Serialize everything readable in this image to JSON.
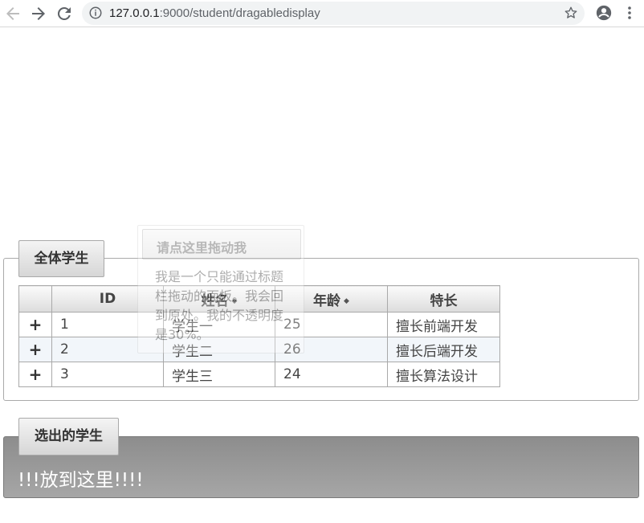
{
  "browser": {
    "url_host": "127.0.0.1",
    "url_rest": ":9000/student/dragabledisplay"
  },
  "all_students": {
    "button_label": "全体学生",
    "headers": [
      "ID",
      "姓名",
      "年龄",
      "特长"
    ],
    "rows": [
      {
        "expand": "+",
        "id": "1",
        "name": "学生一",
        "age": "25",
        "skill": "擅长前端开发"
      },
      {
        "expand": "+",
        "id": "2",
        "name": "学生二",
        "age": "26",
        "skill": "擅长后端开发"
      },
      {
        "expand": "+",
        "id": "3",
        "name": "学生三",
        "age": "24",
        "skill": "擅长算法设计"
      }
    ]
  },
  "selected_students": {
    "button_label": "选出的学生",
    "drop_text": "!!!放到这里!!!!"
  },
  "drag_panel": {
    "title": "请点这里拖动我",
    "body": "我是一个只能通过标题栏拖动的面板。我会回到原处。我的不透明度是30%。"
  },
  "colors": {
    "drop_zone": "#999999",
    "alt_row": "#f2f6fa"
  }
}
